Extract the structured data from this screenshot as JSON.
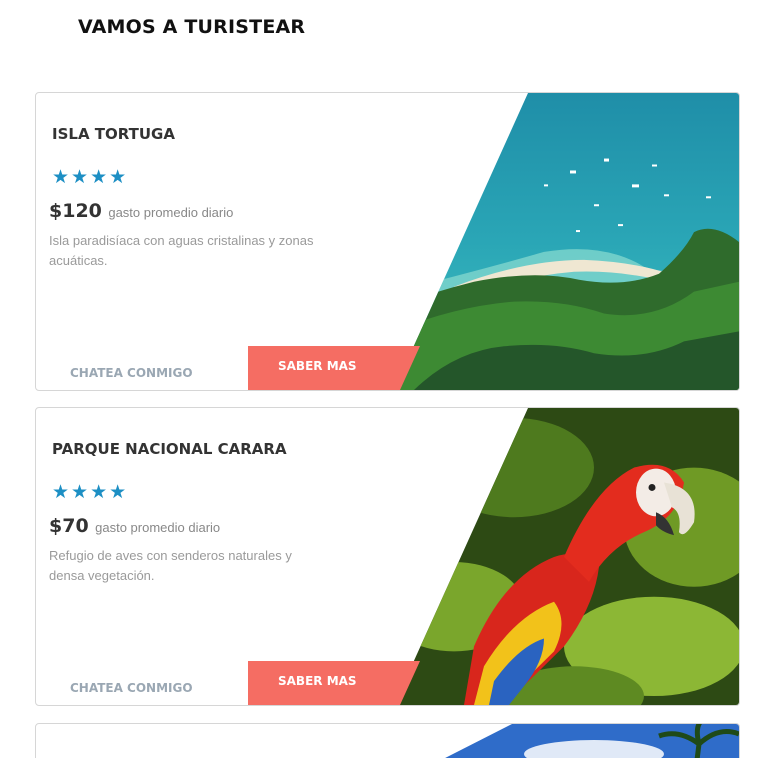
{
  "header": {
    "title": "VAMOS A TURISTEAR"
  },
  "cards": [
    {
      "title": "ISLA TORTUGA",
      "stars": "★★★★",
      "rating": 4,
      "price": "$120",
      "price_note": "gasto promedio diario",
      "description": "Isla paradisíaca con aguas cristalinas y zonas acuáticas.",
      "chat_label": "CHATEA CONMIGO",
      "more_label": "SABER MAS",
      "image": "aerial-beach-island-photo"
    },
    {
      "title": "PARQUE NACIONAL CARARA",
      "stars": "★★★★",
      "rating": 4,
      "price": "$70",
      "price_note": "gasto promedio diario",
      "description": "Refugio de aves con senderos naturales y densa vegetación.",
      "chat_label": "CHATEA CONMIGO",
      "more_label": "SABER MAS",
      "image": "scarlet-macaw-photo"
    },
    {
      "image": "sky-palm-tree-photo"
    }
  ],
  "colors": {
    "accent": "#f56d63",
    "stars": "#1d8fc4",
    "muted": "#9aa7b3"
  }
}
